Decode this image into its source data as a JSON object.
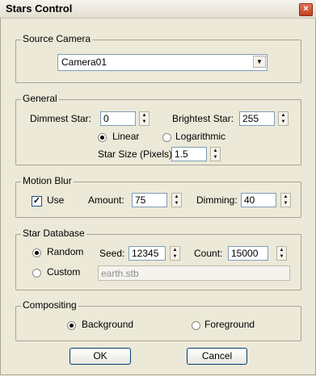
{
  "window": {
    "title": "Stars Control",
    "close_glyph": "×"
  },
  "source_camera": {
    "legend": "Source Camera",
    "value": "Camera01"
  },
  "general": {
    "legend": "General",
    "dimmest_label": "Dimmest Star:",
    "dimmest_value": "0",
    "brightest_label": "Brightest Star:",
    "brightest_value": "255",
    "linear_label": "Linear",
    "log_label": "Logarithmic",
    "scale_selected": "Linear",
    "size_label": "Star Size (Pixels):",
    "size_value": "1.5"
  },
  "motion_blur": {
    "legend": "Motion Blur",
    "use_label": "Use",
    "use_checked": true,
    "check_glyph": "✓",
    "amount_label": "Amount:",
    "amount_value": "75",
    "dimming_label": "Dimming:",
    "dimming_value": "40"
  },
  "star_database": {
    "legend": "Star Database",
    "random_label": "Random",
    "custom_label": "Custom",
    "selected": "Random",
    "seed_label": "Seed:",
    "seed_value": "12345",
    "count_label": "Count:",
    "count_value": "15000",
    "custom_file": "earth.stb"
  },
  "compositing": {
    "legend": "Compositing",
    "background_label": "Background",
    "foreground_label": "Foreground",
    "selected": "Background"
  },
  "buttons": {
    "ok": "OK",
    "cancel": "Cancel"
  },
  "glyphs": {
    "up": "▲",
    "down": "▼"
  }
}
